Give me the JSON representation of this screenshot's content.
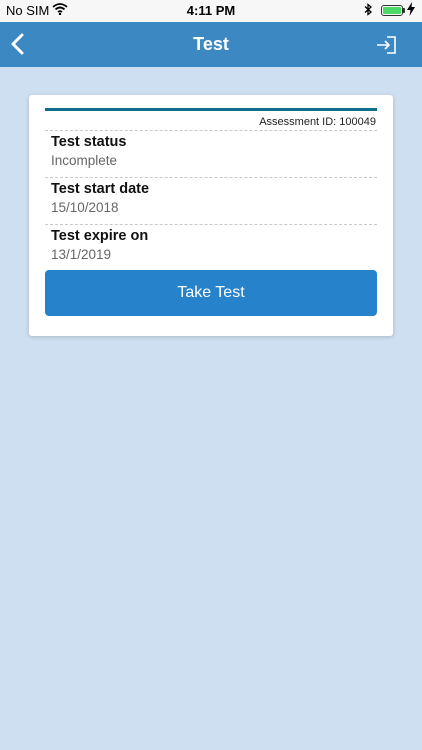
{
  "status_bar": {
    "carrier": "No SIM",
    "time": "4:11 PM",
    "battery_color": "#4cd964"
  },
  "header": {
    "title": "Test",
    "back_icon": "chevron-left-icon",
    "logout_icon": "logout-icon",
    "color": "#3c88c2"
  },
  "card": {
    "assessment_id": "Assessment ID: 100049",
    "accent_color": "#0e6e8e",
    "fields": [
      {
        "label": "Test status",
        "value": "Incomplete"
      },
      {
        "label": "Test start date",
        "value": "15/10/2018"
      },
      {
        "label": "Test expire on",
        "value": "13/1/2019"
      }
    ],
    "button_label": "Take Test",
    "button_color": "#2582cb"
  }
}
